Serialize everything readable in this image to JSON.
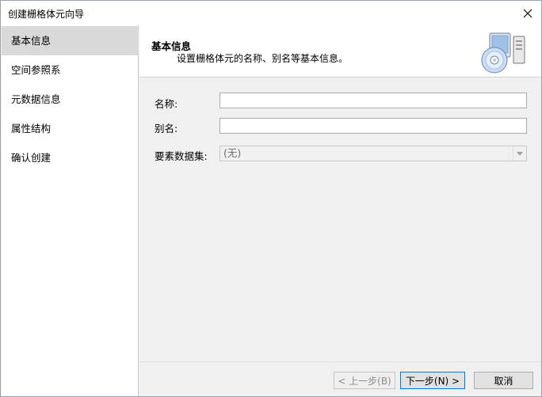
{
  "window": {
    "title": "创建栅格体元向导"
  },
  "sidebar": {
    "items": [
      {
        "label": "基本信息",
        "active": true
      },
      {
        "label": "空间参照系",
        "active": false
      },
      {
        "label": "元数据信息",
        "active": false
      },
      {
        "label": "属性结构",
        "active": false
      },
      {
        "label": "确认创建",
        "active": false
      }
    ]
  },
  "header": {
    "title": "基本信息",
    "description": "设置栅格体元的名称、别名等基本信息。",
    "icon": "computer-disc-icon"
  },
  "form": {
    "name_label": "名称:",
    "name_value": "",
    "alias_label": "别名:",
    "alias_value": "",
    "dataset_label": "要素数据集:",
    "dataset_value": "(无)"
  },
  "footer": {
    "prev_label": "< 上一步(B)",
    "next_label": "下一步(N) >",
    "cancel_label": "取消"
  },
  "colors": {
    "active_item": "#d9d9d9",
    "primary_border": "#0078d7"
  }
}
